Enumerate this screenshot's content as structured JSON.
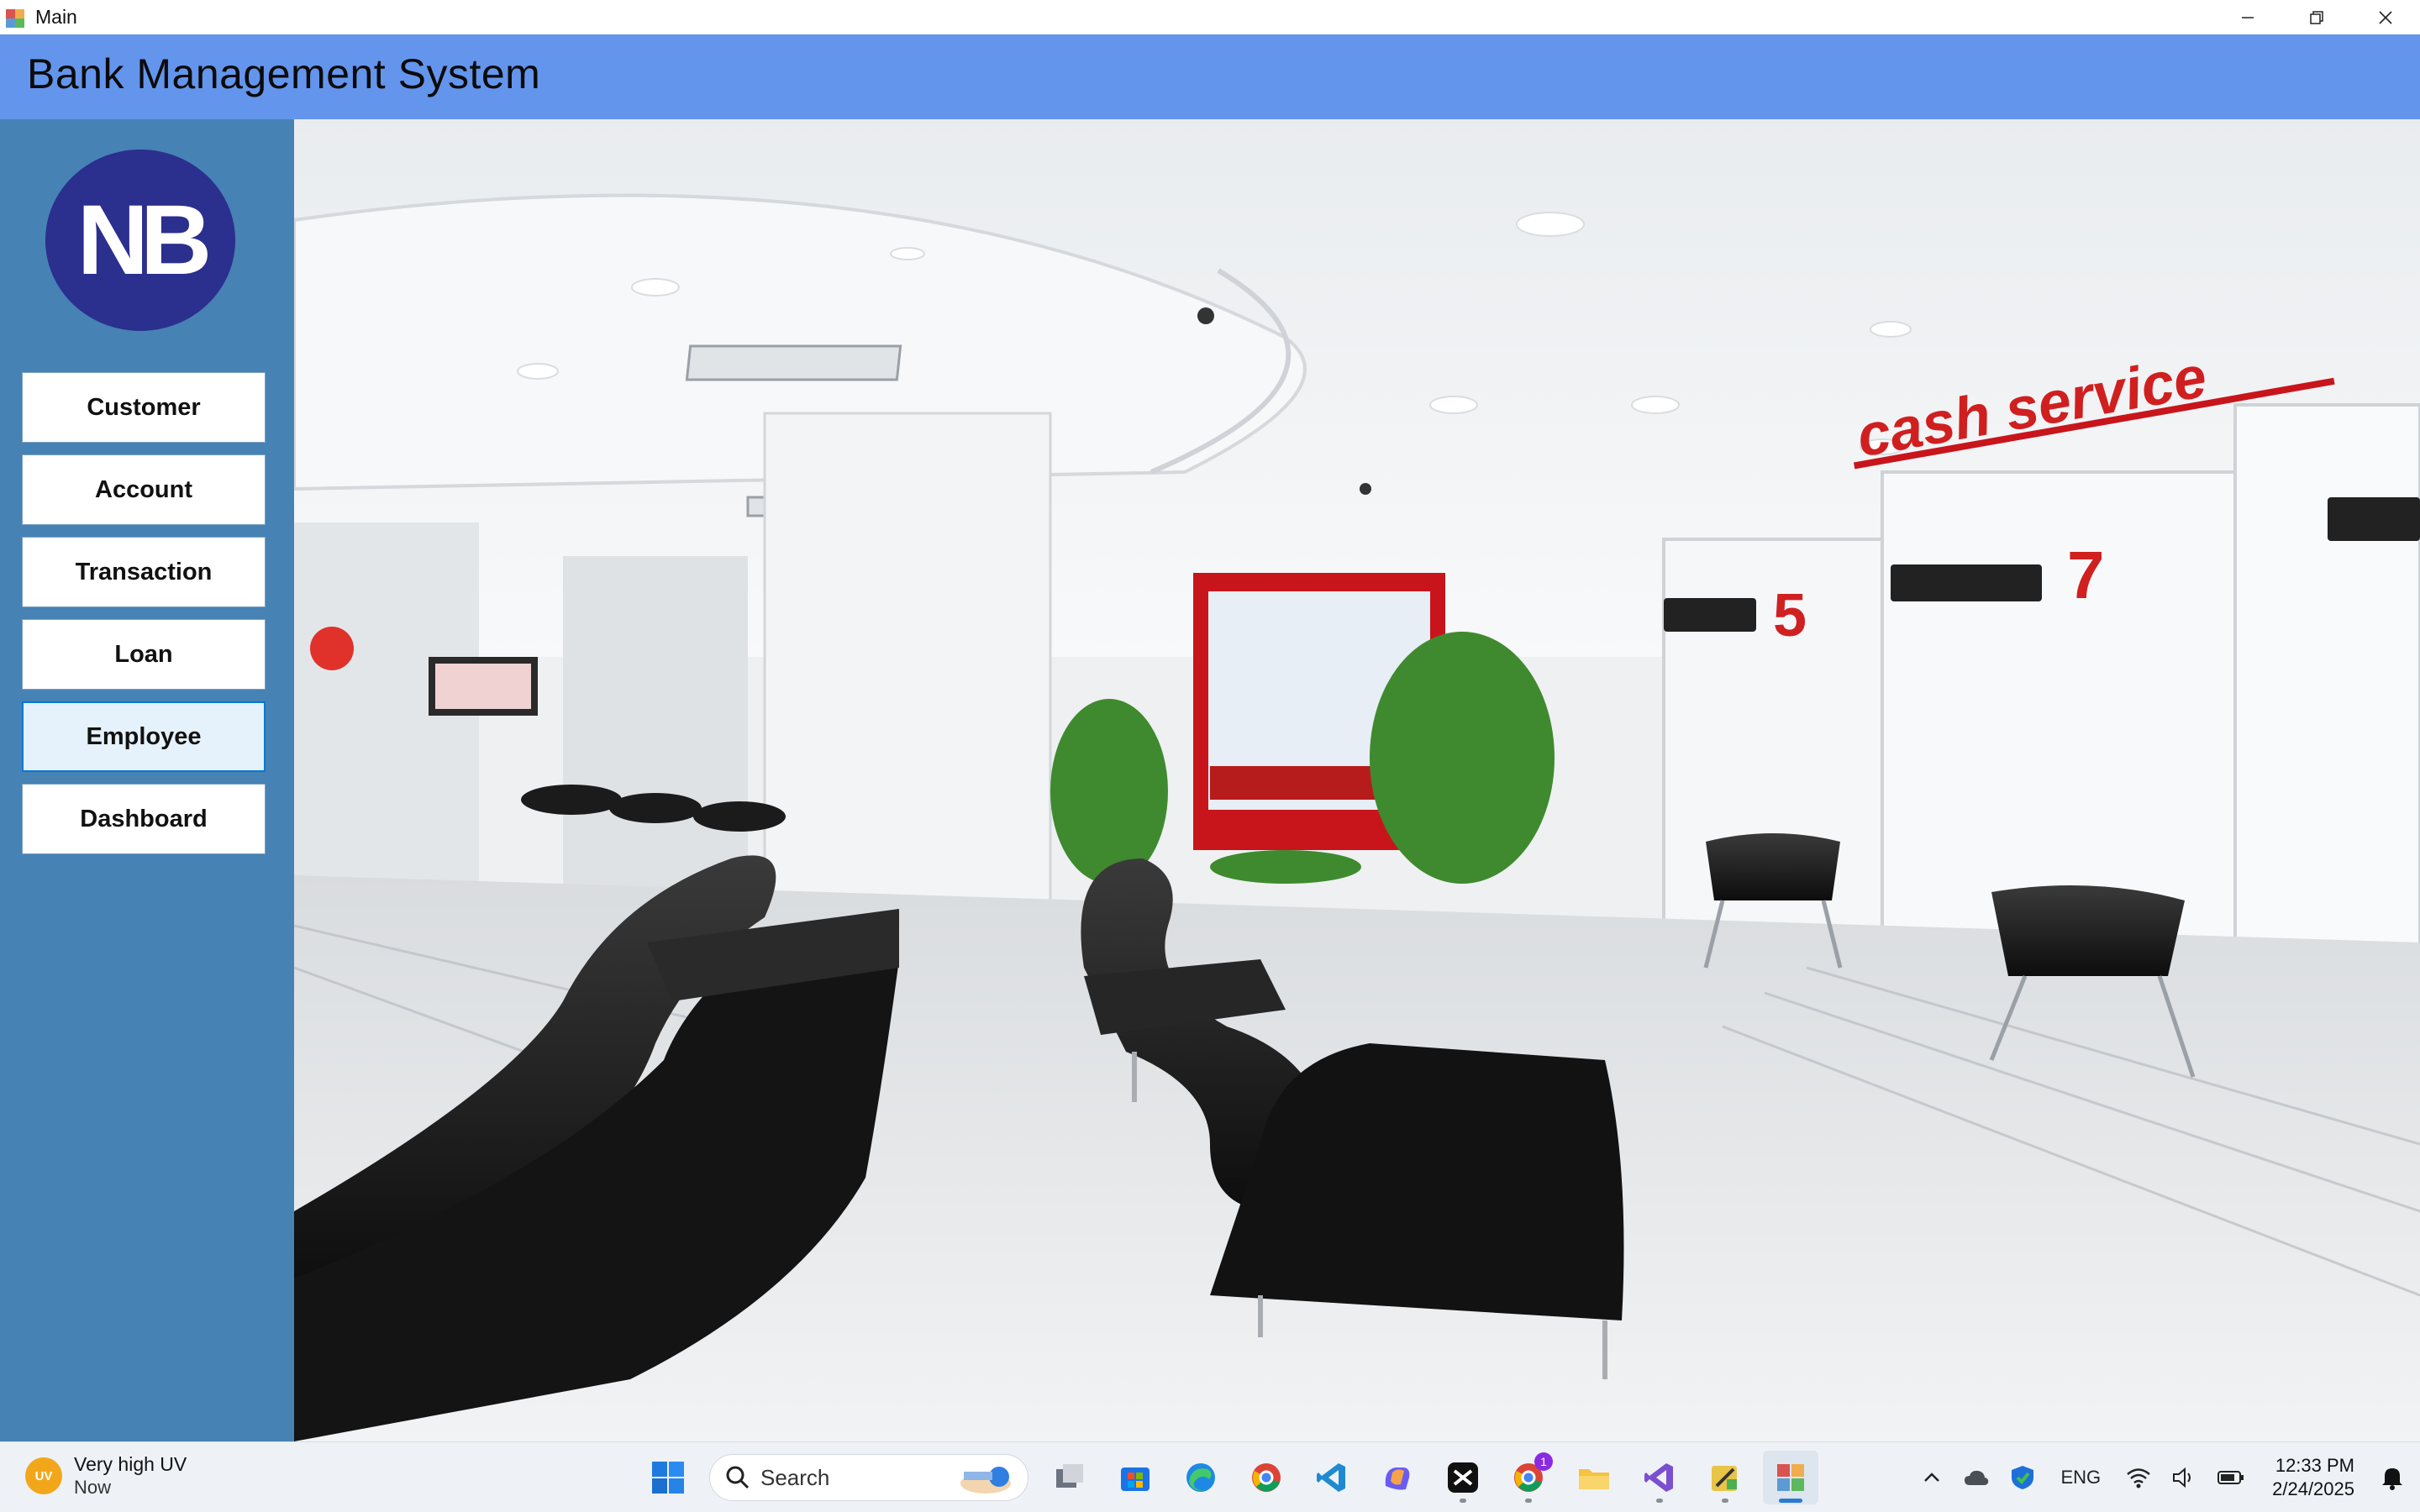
{
  "window": {
    "title": "Main"
  },
  "header": {
    "title": "Bank Management System"
  },
  "sidebar": {
    "logo_text": "NB",
    "items": [
      {
        "label": "Customer"
      },
      {
        "label": "Account"
      },
      {
        "label": "Transaction"
      },
      {
        "label": "Loan"
      },
      {
        "label": "Employee"
      },
      {
        "label": "Dashboard"
      }
    ]
  },
  "photo": {
    "sign_text": "cash service"
  },
  "taskbar": {
    "weather": {
      "badge": "UV",
      "line1": "Very high UV",
      "line2": "Now"
    },
    "search_label": "Search",
    "chrome_badge": "1",
    "language": "ENG",
    "time": "12:33 PM",
    "date": "2/24/2025"
  },
  "colors": {
    "header": "#6495ed",
    "sidebar": "#4682b4",
    "logo": "#2b2f8e",
    "button_hover": "#e5f1fb"
  }
}
